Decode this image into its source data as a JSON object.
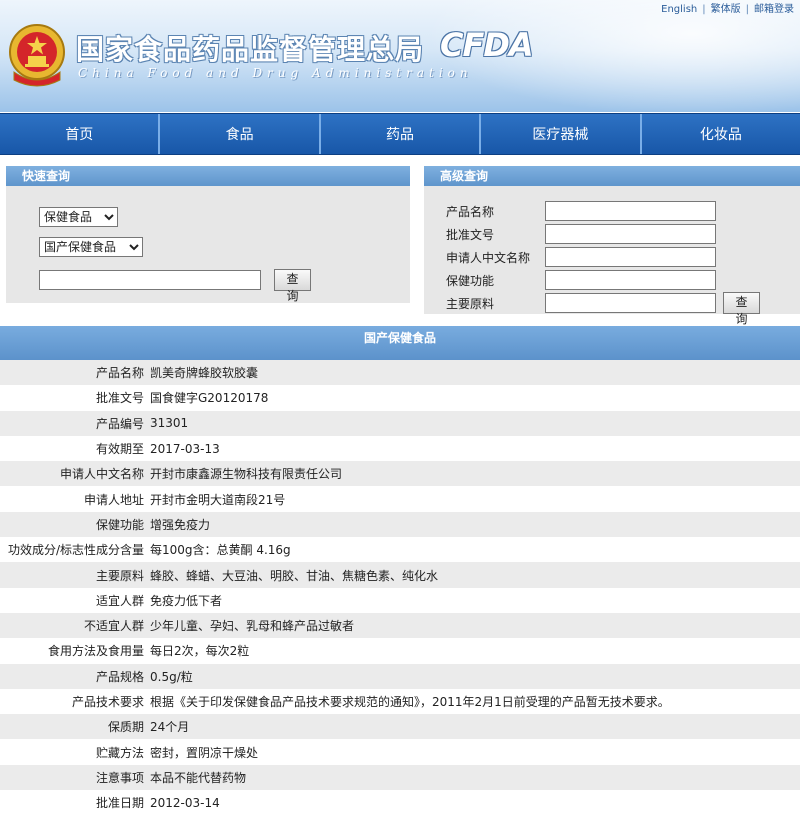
{
  "header": {
    "title_cn": "国家食品药品监督管理总局",
    "title_en": "China Food and Drug Administration",
    "logo_text": "CFDA",
    "top_links": [
      "English",
      "繁体版",
      "邮箱登录"
    ]
  },
  "nav": [
    "首页",
    "食品",
    "药品",
    "医疗器械",
    "化妆品"
  ],
  "quick_search": {
    "title": "快速查询",
    "category_selected": "保健食品",
    "subcategory_selected": "国产保健食品",
    "input_value": "",
    "button": "查询"
  },
  "advanced_search": {
    "title": "高级查询",
    "fields": [
      "产品名称",
      "批准文号",
      "申请人中文名称",
      "保健功能",
      "主要原料"
    ],
    "button": "查询"
  },
  "result": {
    "title": "国产保健食品",
    "rows": [
      {
        "k": "产品名称",
        "v": "凯美奇牌蜂胶软胶囊"
      },
      {
        "k": "批准文号",
        "v": "国食健字G20120178"
      },
      {
        "k": "产品编号",
        "v": "31301"
      },
      {
        "k": "有效期至",
        "v": "2017-03-13"
      },
      {
        "k": "申请人中文名称",
        "v": "开封市康鑫源生物科技有限责任公司"
      },
      {
        "k": "申请人地址",
        "v": "开封市金明大道南段21号"
      },
      {
        "k": "保健功能",
        "v": "增强免疫力"
      },
      {
        "k": "功效成分/标志性成分含量",
        "v": "每100g含：总黄酮 4.16g"
      },
      {
        "k": "主要原料",
        "v": "蜂胶、蜂蜡、大豆油、明胶、甘油、焦糖色素、纯化水"
      },
      {
        "k": "适宜人群",
        "v": "免疫力低下者"
      },
      {
        "k": "不适宜人群",
        "v": "少年儿童、孕妇、乳母和蜂产品过敏者"
      },
      {
        "k": "食用方法及食用量",
        "v": "每日2次，每次2粒"
      },
      {
        "k": "产品规格",
        "v": "0.5g/粒"
      },
      {
        "k": "产品技术要求",
        "v": "根据《关于印发保健食品产品技术要求规范的通知》，2011年2月1日前受理的产品暂无技术要求。"
      },
      {
        "k": "保质期",
        "v": "24个月"
      },
      {
        "k": "贮藏方法",
        "v": "密封，置阴凉干燥处"
      },
      {
        "k": "注意事项",
        "v": "本品不能代替药物"
      },
      {
        "k": "批准日期",
        "v": "2012-03-14"
      }
    ]
  }
}
